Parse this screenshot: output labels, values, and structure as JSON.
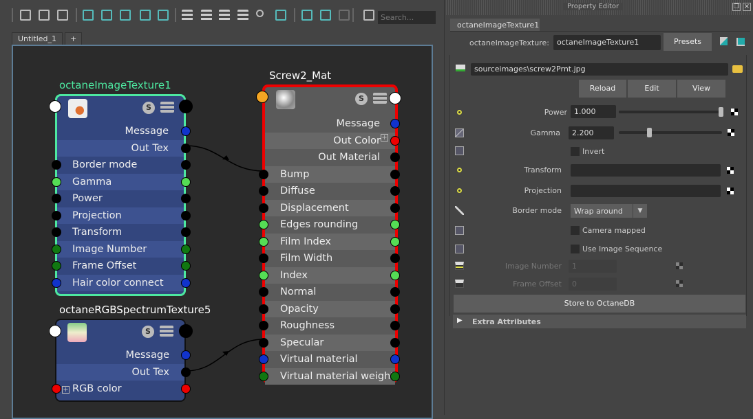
{
  "toolbar": {
    "search_placeholder": "Search...",
    "icons": [
      "frame-selection-icon",
      "frame-all-icon",
      "frame-next-icon",
      "graph-materials-icon",
      "add-selected-icon",
      "remove-selected-icon",
      "input-connections-icon",
      "output-connections-icon",
      "layout-simple-icon",
      "layout-medium-icon",
      "layout-full-icon",
      "layout-custom-icon",
      "search-icon",
      "snapshot-icon",
      "grid-icon",
      "snap-grid-icon",
      "dock-icon",
      "toggle-panel-icon"
    ]
  },
  "tabs": [
    {
      "label": "Untitled_1"
    },
    {
      "label": "+"
    }
  ],
  "port_colors": {
    "white": "#ffffff",
    "black": "#000000",
    "blue": "#1133cc",
    "red": "#ee0000",
    "green": "#55dd55",
    "darkgreen": "#117711",
    "orange": "#f5a623"
  },
  "nodes": {
    "image_texture": {
      "title": "octaneImageTexture1",
      "title_color": "#4de8a0",
      "border_color": "#4de8a0",
      "outputs": [
        {
          "label": "Message",
          "port": "blue"
        },
        {
          "label": "Out Tex",
          "port": "black"
        }
      ],
      "inputs": [
        {
          "label": "Border mode",
          "port": "black"
        },
        {
          "label": "Gamma",
          "port": "green"
        },
        {
          "label": "Power",
          "port": "black"
        },
        {
          "label": "Projection",
          "port": "black"
        },
        {
          "label": "Transform",
          "port": "black"
        },
        {
          "label": "Image Number",
          "port": "darkgreen"
        },
        {
          "label": "Frame Offset",
          "port": "darkgreen"
        },
        {
          "label": "Hair color connect",
          "port": "blue"
        }
      ]
    },
    "rgb_texture": {
      "title": "octaneRGBSpectrumTexture5",
      "title_color": "#ffffff",
      "outputs": [
        {
          "label": "Message",
          "port": "blue"
        },
        {
          "label": "Out Tex",
          "port": "black"
        }
      ],
      "inputs": [
        {
          "label": "RGB color",
          "port": "red",
          "expandable": true
        }
      ]
    },
    "material": {
      "title": "Screw2_Mat",
      "title_color": "#ffffff",
      "border_color": "#ee0000",
      "outputs": [
        {
          "label": "Message",
          "port": "blue"
        },
        {
          "label": "Out Color",
          "port": "red",
          "expandable": true
        },
        {
          "label": "Out Material",
          "port": "black"
        }
      ],
      "inputs": [
        {
          "label": "Bump",
          "port": "black"
        },
        {
          "label": "Diffuse",
          "port": "black"
        },
        {
          "label": "Displacement",
          "port": "black"
        },
        {
          "label": "Edges rounding",
          "port": "green"
        },
        {
          "label": "Film Index",
          "port": "green"
        },
        {
          "label": "Film Width",
          "port": "black"
        },
        {
          "label": "Index",
          "port": "green"
        },
        {
          "label": "Normal",
          "port": "black"
        },
        {
          "label": "Opacity",
          "port": "black"
        },
        {
          "label": "Roughness",
          "port": "black"
        },
        {
          "label": "Specular",
          "port": "black"
        },
        {
          "label": "Virtual material",
          "port": "blue"
        },
        {
          "label": "Virtual material weight",
          "port": "darkgreen"
        }
      ]
    }
  },
  "connections": [
    {
      "from": "octaneImageTexture1.Out Tex",
      "to": "Screw2_Mat.Bump"
    },
    {
      "from": "octaneRGBSpectrumTexture5.Out Tex",
      "to": "Screw2_Mat.Specular"
    }
  ],
  "property_editor": {
    "title": "Property Editor",
    "tab": "octaneImageTexture1",
    "node_type_label": "octaneImageTexture:",
    "node_name": "octaneImageTexture1",
    "presets": "Presets",
    "file_path": "sourceimages\\screw2Prnt.jpg",
    "reload": "Reload",
    "edit": "Edit",
    "view": "View",
    "power_label": "Power",
    "power_value": "1.000",
    "power_slider": 1.0,
    "gamma_label": "Gamma",
    "gamma_value": "2.200",
    "gamma_slider": 0.28,
    "invert_label": "Invert",
    "transform_label": "Transform",
    "projection_label": "Projection",
    "border_mode_label": "Border mode",
    "border_mode_value": "Wrap around",
    "camera_mapped_label": "Camera mapped",
    "use_image_sequence_label": "Use Image Sequence",
    "image_number_label": "Image Number",
    "image_number_value": "1",
    "frame_offset_label": "Frame Offset",
    "frame_offset_value": "0",
    "store_button": "Store to OctaneDB",
    "extra_attributes": "Extra Attributes"
  }
}
